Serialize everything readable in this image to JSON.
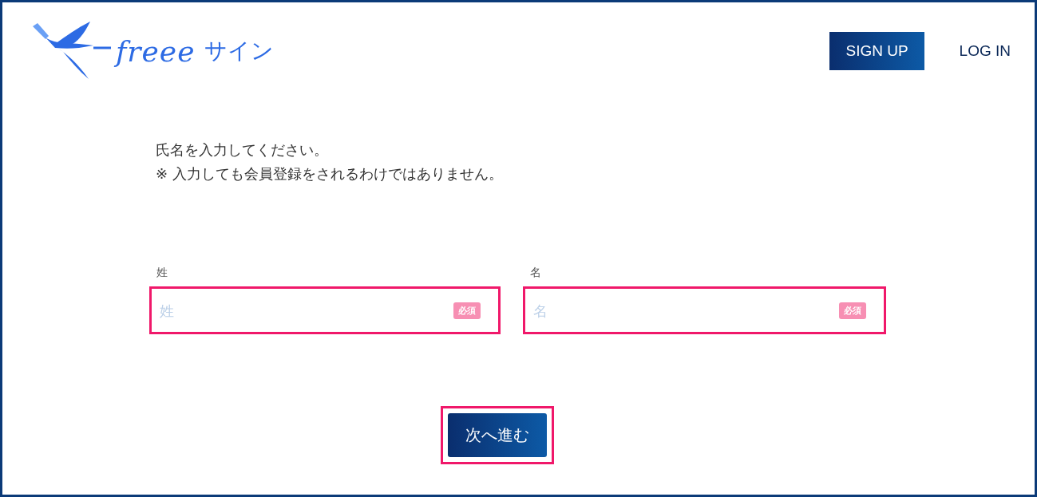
{
  "header": {
    "logo": {
      "wordmark": "freee",
      "product": "サイン"
    },
    "nav": [
      {
        "label": "SIGN UP",
        "kind": "primary"
      },
      {
        "label": "LOG IN",
        "kind": "link"
      }
    ]
  },
  "instructions": [
    "氏名を入力してください。",
    "※ 入力しても会員登録をされるわけではありません。"
  ],
  "fields": [
    {
      "label": "姓",
      "placeholder": "姓",
      "badge": "必須",
      "highlighted": true
    },
    {
      "label": "名",
      "placeholder": "名",
      "badge": "必須",
      "highlighted": true
    }
  ],
  "submit": {
    "label": "次へ進む",
    "highlighted": true
  }
}
